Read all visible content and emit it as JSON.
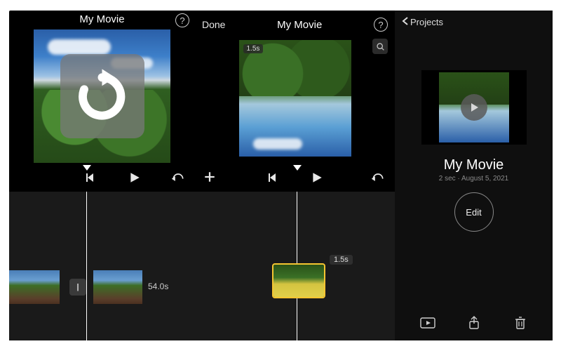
{
  "panel1": {
    "title": "My Movie",
    "help_label": "?",
    "controls": {
      "prev_icon": "skip-back",
      "play_icon": "play",
      "undo_icon": "undo"
    },
    "timeline": {
      "transition_label": "|",
      "clip_duration": "54.0s"
    }
  },
  "panel2": {
    "done_label": "Done",
    "title": "My Movie",
    "help_label": "?",
    "preview_badge": "1.5s",
    "controls": {
      "add_icon": "plus",
      "prev_icon": "skip-back",
      "play_icon": "play",
      "undo_icon": "undo"
    },
    "timeline": {
      "clip_duration": "1.5s"
    }
  },
  "panel3": {
    "back_label": "Projects",
    "title": "My Movie",
    "meta": "2 sec · August 5, 2021",
    "edit_label": "Edit",
    "actions": {
      "play": "play-rect",
      "share": "share",
      "delete": "trash"
    }
  }
}
